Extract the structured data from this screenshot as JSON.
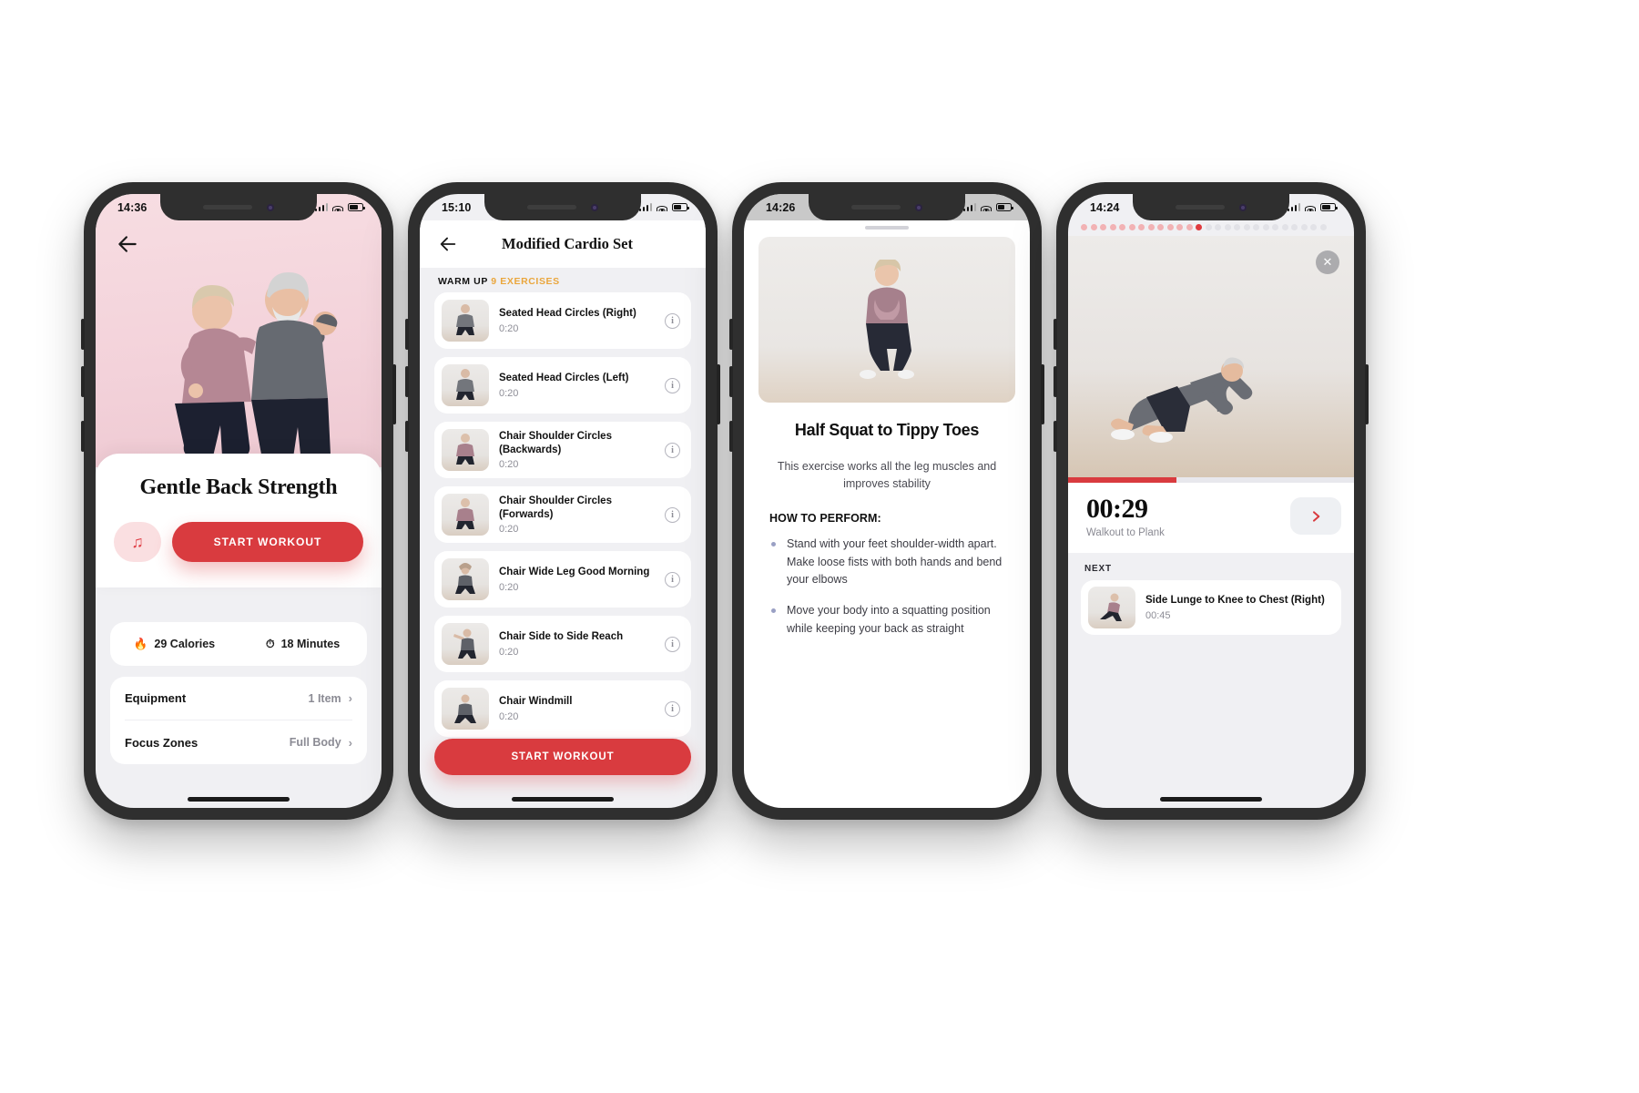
{
  "phone1": {
    "status": {
      "time": "14:36"
    },
    "back_icon": "back-arrow-icon",
    "title": "Gentle Back Strength",
    "music_icon": "music-note-icon",
    "start_label": "START WORKOUT",
    "stats": [
      {
        "icon": "flame-icon",
        "label": "29 Calories"
      },
      {
        "icon": "stopwatch-icon",
        "label": "18 Minutes"
      }
    ],
    "rows": [
      {
        "label": "Equipment",
        "value": "1 Item",
        "chevron": "›"
      },
      {
        "label": "Focus Zones",
        "value": "Full Body",
        "chevron": "›"
      }
    ]
  },
  "phone2": {
    "status": {
      "time": "15:10"
    },
    "title": "Modified Cardio Set",
    "section": {
      "label": "WARM UP",
      "count": "9 EXERCISES"
    },
    "start_label": "START WORKOUT",
    "info_icon": "info-icon",
    "exercises": [
      {
        "name": "Seated Head Circles (Right)",
        "duration": "0:20"
      },
      {
        "name": "Seated Head Circles (Left)",
        "duration": "0:20"
      },
      {
        "name": "Chair Shoulder Circles (Backwards)",
        "duration": "0:20"
      },
      {
        "name": "Chair Shoulder Circles (Forwards)",
        "duration": "0:20"
      },
      {
        "name": "Chair Wide Leg Good Morning",
        "duration": "0:20"
      },
      {
        "name": "Chair Side to Side Reach",
        "duration": "0:20"
      },
      {
        "name": "Chair Windmill",
        "duration": "0:20"
      }
    ]
  },
  "phone3": {
    "status": {
      "time": "14:26"
    },
    "title": "Half Squat to Tippy Toes",
    "description": "This exercise works all the leg muscles and improves stability",
    "how_label": "HOW TO PERFORM:",
    "steps": [
      "Stand with your feet shoulder-width apart. Make loose fists with both hands and bend your elbows",
      "Move your body into a squatting position while keeping your back as straight"
    ]
  },
  "phone4": {
    "status": {
      "time": "14:24"
    },
    "close_icon": "close-icon",
    "progress_dots": {
      "done": 12,
      "current": 1,
      "remaining": 13
    },
    "progress_percent": 38,
    "timer": "00:29",
    "current_exercise": "Walkout to Plank",
    "next_icon": "chevron-right-icon",
    "next_label": "NEXT",
    "next_exercise": {
      "name": "Side Lunge to Knee to Chest (Right)",
      "duration": "00:45"
    }
  },
  "colors": {
    "accent": "#d93b3f",
    "accent_soft": "#fadfe1",
    "amber": "#eaa63c",
    "bg": "#f0f0f3"
  }
}
